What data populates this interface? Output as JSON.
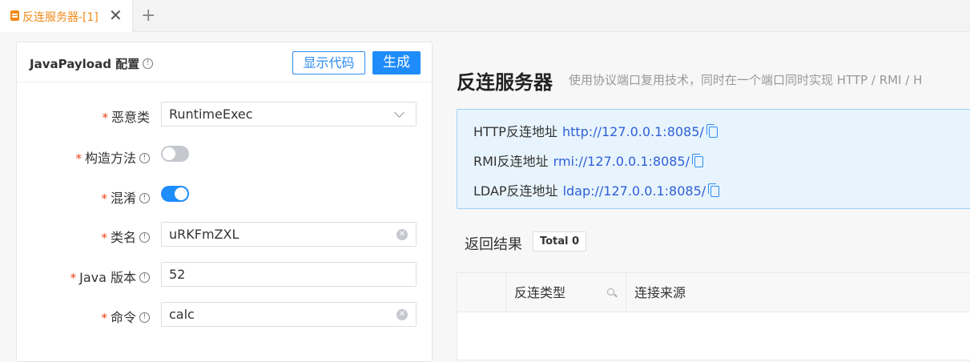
{
  "tabs": [
    {
      "label": "反连服务器-[1]",
      "close": "✕"
    }
  ],
  "tab_add": "+",
  "config_panel": {
    "title": "JavaPayload 配置",
    "show_code_label": "显示代码",
    "generate_label": "生成",
    "fields": {
      "malicious_class": {
        "label": "恶意类",
        "value": "RuntimeExec"
      },
      "constructor": {
        "label": "构造方法",
        "enabled": false
      },
      "obfuscate": {
        "label": "混淆",
        "enabled": true
      },
      "class_name": {
        "label": "类名",
        "value": "uRKFmZXL"
      },
      "java_version": {
        "label": "Java 版本",
        "value": "52"
      },
      "command": {
        "label": "命令",
        "value": "calc"
      }
    }
  },
  "server": {
    "title": "反连服务器",
    "description": "使用协议端口复用技术，同时在一个端口同时实现 HTTP / RMI / H",
    "addresses": [
      {
        "label": "HTTP反连地址",
        "url": "http://127.0.0.1:8085/"
      },
      {
        "label": "RMI反连地址",
        "url": "rmi://127.0.0.1:8085/"
      },
      {
        "label": "LDAP反连地址",
        "url": "ldap://127.0.0.1:8085/"
      }
    ],
    "result_label": "返回结果",
    "total_badge": "Total 0",
    "table_columns": [
      "",
      "反连类型",
      "连接来源"
    ]
  },
  "colors": {
    "accent": "#1e8cfa",
    "tab_active": "#f08a1a",
    "required": "#ed4014"
  }
}
